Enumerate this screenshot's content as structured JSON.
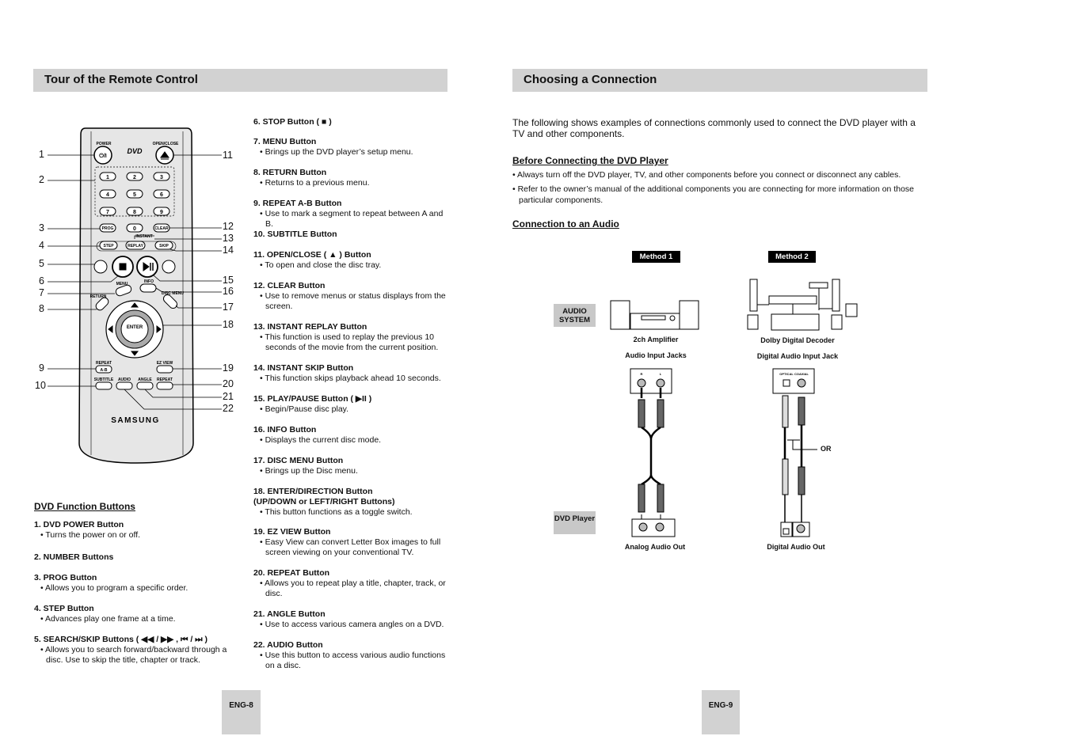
{
  "left_page": {
    "title": "Tour of the Remote Control",
    "remote": {
      "brand": "SAMSUNG",
      "power": "POWER",
      "power_symbol": "⏻/I",
      "dvd_logo": "DVD",
      "open_close": "OPEN/CLOSE",
      "numbers": [
        "1",
        "2",
        "3",
        "4",
        "5",
        "6",
        "7",
        "8",
        "9",
        "0"
      ],
      "prog": "PROG",
      "clear": "CLEAR",
      "instant": "INSTANT",
      "step": "STEP",
      "replay": "REPLAY",
      "skip": "SKIP",
      "menu": "MENU",
      "info": "INFO",
      "return": "RETURN",
      "disc_menu": "DISC MENU",
      "enter": "ENTER",
      "repeat_label": "REPEAT",
      "repeat_ab": "A-B",
      "ez_view": "EZ VIEW",
      "subtitle": "SUBTITLE",
      "audio": "AUDIO",
      "angle": "ANGLE",
      "repeat": "REPEAT"
    },
    "callouts_left": [
      "1",
      "2",
      "3",
      "4",
      "5",
      "6",
      "7",
      "8",
      "9",
      "10"
    ],
    "callouts_right": [
      "11",
      "12",
      "13",
      "14",
      "15",
      "16",
      "17",
      "18",
      "19",
      "20",
      "21",
      "22"
    ],
    "section_title": "DVD Function Buttons",
    "items_col1": [
      {
        "title": "1. DVD POWER Button",
        "desc": [
          "• Turns the power on or off."
        ]
      },
      {
        "title": "2. NUMBER Buttons",
        "desc": []
      },
      {
        "title": "3. PROG Button",
        "desc": [
          "• Allows you to program a specific order."
        ]
      },
      {
        "title": "4. STEP Button",
        "desc": [
          "• Advances play one frame at a time."
        ]
      },
      {
        "title": "5. SEARCH/SKIP Buttons ( ◀◀ / ▶▶ , ⏮ / ⏭ )",
        "desc": [
          "• Allows you to search forward/backward through a disc. Use to skip the title, chapter or track."
        ]
      }
    ],
    "items_col2": [
      {
        "title": "6. STOP Button ( ■ )",
        "desc": []
      },
      {
        "title": "7. MENU Button",
        "desc": [
          "• Brings up the DVD player’s setup menu."
        ]
      },
      {
        "title": "8. RETURN Button",
        "desc": [
          "• Returns to a previous menu."
        ]
      },
      {
        "title": "9. REPEAT A-B Button",
        "desc": [
          "• Use to mark a segment to repeat between A and B."
        ]
      },
      {
        "title": "10. SUBTITLE Button",
        "desc": []
      },
      {
        "title": "11. OPEN/CLOSE ( ▲ ) Button",
        "desc": [
          "• To open and close the disc tray."
        ]
      },
      {
        "title": "12. CLEAR Button",
        "desc": [
          "• Use to remove menus or status displays from the screen."
        ]
      },
      {
        "title": "13. INSTANT REPLAY Button",
        "desc": [
          "• This function is used to replay the previous 10 seconds of the movie from the current position."
        ]
      },
      {
        "title": "14. INSTANT SKIP Button",
        "desc": [
          "• This function skips playback ahead 10 seconds."
        ]
      },
      {
        "title": "15. PLAY/PAUSE Button ( ▶II )",
        "desc": [
          "• Begin/Pause disc play."
        ]
      },
      {
        "title": "16. INFO Button",
        "desc": [
          "• Displays the current disc mode."
        ]
      },
      {
        "title": "17. DISC MENU Button",
        "desc": [
          "• Brings up the Disc menu."
        ]
      },
      {
        "title": "18. ENTER/DIRECTION Button\n     (UP/DOWN or LEFT/RIGHT Buttons)",
        "desc": [
          "• This button functions as a toggle switch."
        ]
      },
      {
        "title": "19. EZ VIEW Button",
        "desc": [
          "• Easy View can convert Letter Box images to full screen viewing on your conventional TV."
        ]
      },
      {
        "title": "20. REPEAT Button",
        "desc": [
          "• Allows you to repeat play a title, chapter, track, or disc."
        ]
      },
      {
        "title": "21. ANGLE Button",
        "desc": [
          "• Use to access various camera angles on a DVD."
        ]
      },
      {
        "title": "22. AUDIO Button",
        "desc": [
          "• Use this button to access various audio functions on a disc."
        ]
      }
    ],
    "page_number": "ENG-8"
  },
  "right_page": {
    "title": "Choosing a Connection",
    "intro": "The following shows examples of connections commonly used to connect the DVD player with a TV and other components.",
    "before_title": "Before Connecting the DVD Player",
    "before_bullets": [
      "• Always turn off the DVD player, TV, and other components before you connect or disconnect any cables.",
      "• Refer to the owner’s manual of the additional components you are connecting for more information on those particular components."
    ],
    "connection_title": "Connection to an Audio",
    "diagram": {
      "method1": "Method 1",
      "method2": "Method 2",
      "audio_system": "AUDIO SYSTEM",
      "dvd_player": "DVD Player",
      "amp": "2ch Amplifier",
      "audio_input_jacks": "Audio Input Jacks",
      "decoder": "Dolby Digital Decoder",
      "digital_input": "Digital Audio Input Jack",
      "or": "OR",
      "analog_out": "Analog Audio Out",
      "digital_out": "Digital Audio Out",
      "jack_r": "R",
      "jack_l": "L",
      "optical": "OPTICAL",
      "coaxial": "COAXIAL"
    },
    "page_number": "ENG-9"
  }
}
